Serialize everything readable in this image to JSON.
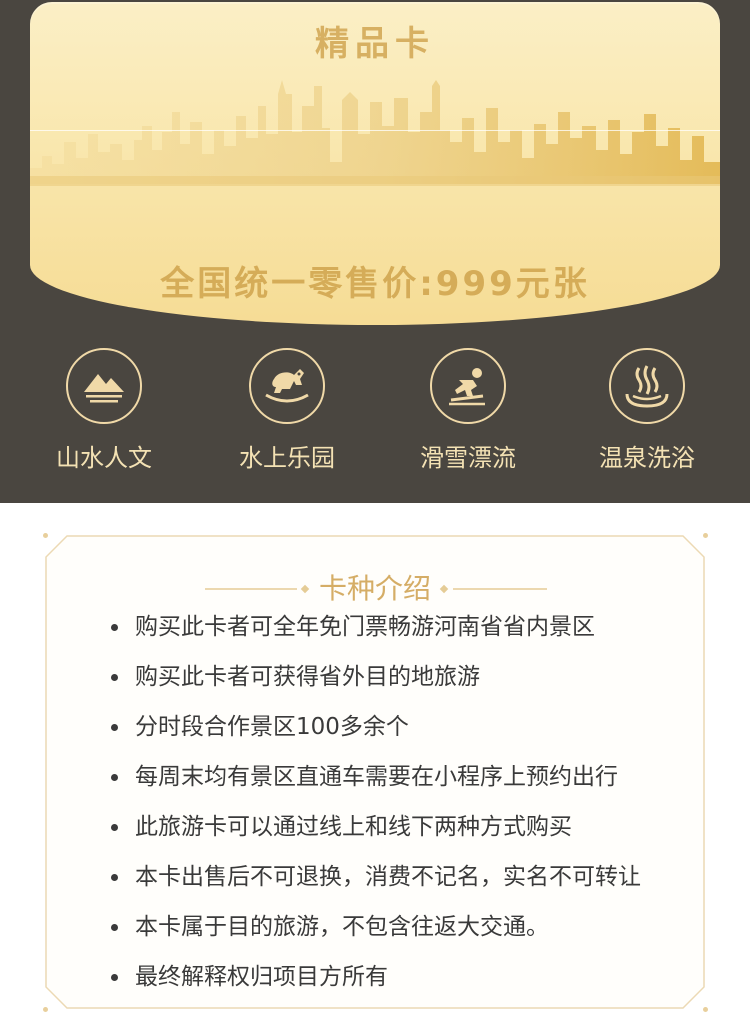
{
  "card": {
    "title": "精品卡",
    "price_text": "全国统一零售价:999元张"
  },
  "categories": [
    {
      "label": "山水人文",
      "icon": "mountain-icon"
    },
    {
      "label": "水上乐园",
      "icon": "rocking-horse-icon"
    },
    {
      "label": "滑雪漂流",
      "icon": "skier-icon"
    },
    {
      "label": "温泉洗浴",
      "icon": "hot-spring-icon"
    }
  ],
  "intro": {
    "title": "卡种介绍",
    "items": [
      "购买此卡者可全年免门票畅游河南省省内景区",
      "购买此卡者可获得省外目的地旅游",
      "分时段合作景区100多余个",
      "每周末均有景区直通车需要在小程序上预约出行",
      "此旅游卡可以通过线上和线下两种方式购买",
      "本卡出售后不可退换，消费不记名，实名不可转让",
      "本卡属于目的旅游，不包含往返大交通。",
      "最终解释权归项目方所有"
    ]
  },
  "colors": {
    "header_bg": "#4a4640",
    "gold_light": "#fbefc6",
    "gold_text": "#d5ac58",
    "category_text": "#f4e2b4",
    "body_text": "#3a3a3a"
  }
}
